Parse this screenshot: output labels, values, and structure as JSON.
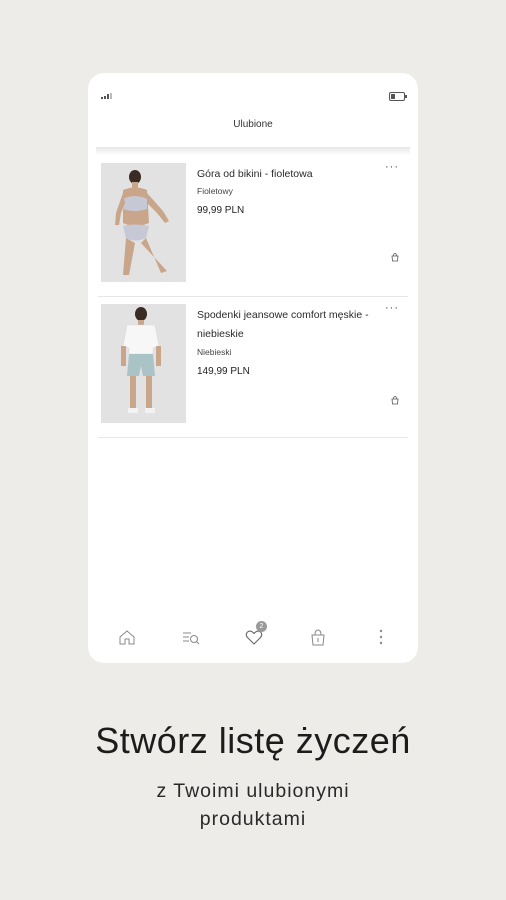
{
  "header": {
    "title": "Ulubione"
  },
  "wishlist": {
    "items": [
      {
        "name": "Góra od bikini - fioletowa",
        "color": "Fioletowy",
        "price": "99,99 PLN"
      },
      {
        "name": "Spodenki jeansowe comfort męskie - niebieskie",
        "color": "Niebieski",
        "price": "149,99 PLN"
      }
    ]
  },
  "tabbar": {
    "items": [
      "home-icon",
      "search-icon",
      "heart-icon",
      "bag-icon",
      "more-icon"
    ],
    "favorites_count": "2"
  },
  "promo": {
    "headline": "Stwórz listę życzeń",
    "subline": "z Twoimi ulubionymi produktami"
  }
}
